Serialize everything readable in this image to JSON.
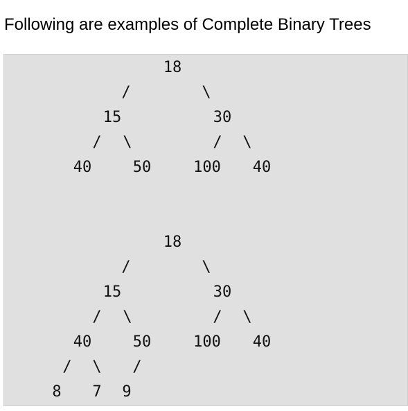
{
  "heading": "Following are examples of Complete Binary Trees",
  "trees": [
    {
      "lines": [
        [
          "18"
        ],
        [
          "/",
          "\\"
        ],
        [
          "15",
          "30"
        ],
        [
          "/",
          "\\",
          "/",
          "\\"
        ],
        [
          "40",
          "50",
          "100",
          "40"
        ]
      ]
    },
    {
      "lines": [
        [
          "18"
        ],
        [
          "/",
          "\\"
        ],
        [
          "15",
          "30"
        ],
        [
          "/",
          "\\",
          "/",
          "\\"
        ],
        [
          "40",
          "50",
          "100",
          "40"
        ],
        [
          "/",
          "\\",
          "/"
        ],
        [
          "8",
          "7",
          "9"
        ]
      ]
    }
  ]
}
